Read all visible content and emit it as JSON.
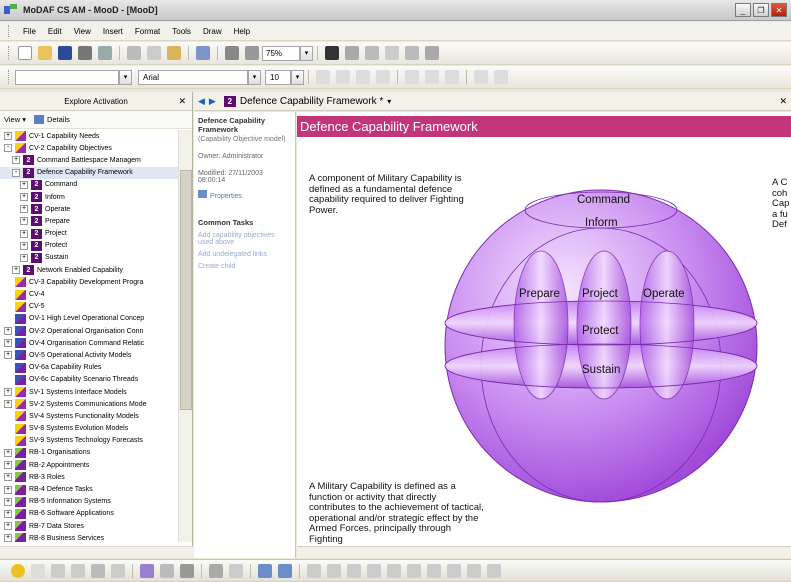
{
  "window": {
    "title": "MoDAF CS AM - MooD - [MooD]",
    "buttons": {
      "minimize": "_",
      "restore": "❐",
      "close": "✕"
    }
  },
  "menu": [
    "File",
    "Edit",
    "View",
    "Insert",
    "Format",
    "Tools",
    "Draw",
    "Help"
  ],
  "toolbar": {
    "zoom": "75%",
    "font_name": "Arial",
    "font_size": "10"
  },
  "explorer": {
    "title": "Explore Activation",
    "view_label": "View",
    "details_label": "Details",
    "items": [
      {
        "label": "CV-1 Capability Needs",
        "level": 0,
        "exp": "+",
        "icon": "y"
      },
      {
        "label": "CV-2 Capability Objectives",
        "level": 0,
        "exp": "-",
        "icon": "y"
      },
      {
        "label": "Command Battlespace Managem",
        "level": 1,
        "exp": "+",
        "icon": "p"
      },
      {
        "label": "Defence Capability Framework",
        "level": 1,
        "exp": "-",
        "icon": "p",
        "selected": true
      },
      {
        "label": "Command",
        "level": 2,
        "exp": "+",
        "icon": "p"
      },
      {
        "label": "Inform",
        "level": 2,
        "exp": "+",
        "icon": "p"
      },
      {
        "label": "Operate",
        "level": 2,
        "exp": "+",
        "icon": "p"
      },
      {
        "label": "Prepare",
        "level": 2,
        "exp": "+",
        "icon": "p"
      },
      {
        "label": "Project",
        "level": 2,
        "exp": "+",
        "icon": "p"
      },
      {
        "label": "Protect",
        "level": 2,
        "exp": "+",
        "icon": "p"
      },
      {
        "label": "Sustain",
        "level": 2,
        "exp": "+",
        "icon": "p"
      },
      {
        "label": "Network Enabled Capability",
        "level": 1,
        "exp": "+",
        "icon": "p"
      },
      {
        "label": "CV-3 Capability Development Progra",
        "level": 0,
        "exp": "",
        "icon": "y"
      },
      {
        "label": "CV-4",
        "level": 0,
        "exp": "",
        "icon": "y"
      },
      {
        "label": "CV-5",
        "level": 0,
        "exp": "",
        "icon": "y"
      },
      {
        "label": "OV-1 High Level Operational Concep",
        "level": 0,
        "exp": "",
        "icon": "b"
      },
      {
        "label": "OV-2 Operational Organisation Conn",
        "level": 0,
        "exp": "+",
        "icon": "b"
      },
      {
        "label": "OV-4 Organisation Command Relatic",
        "level": 0,
        "exp": "+",
        "icon": "b"
      },
      {
        "label": "OV-5 Operational Activity Models",
        "level": 0,
        "exp": "+",
        "icon": "b"
      },
      {
        "label": "OV-6a Capability Rules",
        "level": 0,
        "exp": "",
        "icon": "b"
      },
      {
        "label": "OV-6c Capability Scenario Threads",
        "level": 0,
        "exp": "",
        "icon": "b"
      },
      {
        "label": "SV-1 Systems Interface Models",
        "level": 0,
        "exp": "+",
        "icon": "y"
      },
      {
        "label": "SV-2 Systems Communications Mode",
        "level": 0,
        "exp": "+",
        "icon": "y"
      },
      {
        "label": "SV-4 Systems Functionality Models",
        "level": 0,
        "exp": "",
        "icon": "y"
      },
      {
        "label": "SV-8 Systems Evolution Models",
        "level": 0,
        "exp": "",
        "icon": "y"
      },
      {
        "label": "SV-9 Systems Technology Forecasts",
        "level": 0,
        "exp": "",
        "icon": "y"
      },
      {
        "label": "RB-1 Organisations",
        "level": 0,
        "exp": "+",
        "icon": "v"
      },
      {
        "label": "RB-2 Appointments",
        "level": 0,
        "exp": "+",
        "icon": "v"
      },
      {
        "label": "RB-3 Roles",
        "level": 0,
        "exp": "+",
        "icon": "v"
      },
      {
        "label": "RB-4 Defence Tasks",
        "level": 0,
        "exp": "+",
        "icon": "v"
      },
      {
        "label": "RB-5 Information Systems",
        "level": 0,
        "exp": "+",
        "icon": "v"
      },
      {
        "label": "RB-6 Software Applications",
        "level": 0,
        "exp": "+",
        "icon": "v"
      },
      {
        "label": "RB-7 Data Stores",
        "level": 0,
        "exp": "+",
        "icon": "v"
      },
      {
        "label": "RB-8 Business Services",
        "level": 0,
        "exp": "+",
        "icon": "v"
      }
    ]
  },
  "document": {
    "tab_title": "Defence Capability Framework *",
    "banner": "Defence Capability Framework",
    "intro_text": "A component of Military Capability is defined as a fundamental defence capability required to deliver Fighting Power.",
    "bottom_text": "A Military Capability is defined as a function or activity that directly contributes to the achievement of tactical, operational and/or strategic effect by the Armed Forces, principally through Fighting",
    "side_text": [
      "A C",
      "coh",
      "Cap",
      "a fu",
      "Def"
    ],
    "sphere_labels": [
      "Command",
      "Inform",
      "Prepare",
      "Project",
      "Operate",
      "Protect",
      "Sustain"
    ]
  },
  "task_pane": {
    "title": "Defence Capability Framework",
    "subtitle": "(Capability Objective model)",
    "owner": "Owner: Administrator",
    "modified": "Modified: 27/11/2003 08:00:14",
    "properties_link": "Properties",
    "common_tasks_heading": "Common Tasks",
    "tasks": [
      "Add capability objectives used above",
      "Add undelegated links",
      "Create child"
    ]
  },
  "colors": {
    "banner": "#c2357a",
    "sphere": "#b24de8",
    "title_text": "#222222"
  }
}
